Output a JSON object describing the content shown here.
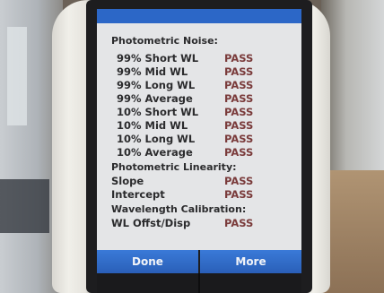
{
  "screen": {
    "sections": [
      {
        "title": "Photometric Noise:",
        "rows": [
          {
            "label": "99% Short WL",
            "status": "PASS"
          },
          {
            "label": "99% Mid WL",
            "status": "PASS"
          },
          {
            "label": "99% Long WL",
            "status": "PASS"
          },
          {
            "label": "99% Average",
            "status": "PASS"
          },
          {
            "label": "10% Short WL",
            "status": "PASS"
          },
          {
            "label": "10% Mid WL",
            "status": "PASS"
          },
          {
            "label": "10% Long WL",
            "status": "PASS"
          },
          {
            "label": "10% Average",
            "status": "PASS"
          }
        ]
      },
      {
        "title": "Photometric Linearity:",
        "rows": [
          {
            "label": "Slope",
            "status": "PASS"
          },
          {
            "label": "Intercept",
            "status": "PASS"
          }
        ]
      },
      {
        "title": "Wavelength Calibration:",
        "rows": [
          {
            "label": "WL Offst/Disp",
            "status": "PASS"
          }
        ]
      }
    ],
    "buttons": {
      "done_label": "Done",
      "more_label": "More"
    }
  },
  "colors": {
    "accent": "#2c67c7",
    "button": "#3a7ad8",
    "status_text": "#7a3b3b",
    "screen_bg": "#e4e5e7"
  }
}
